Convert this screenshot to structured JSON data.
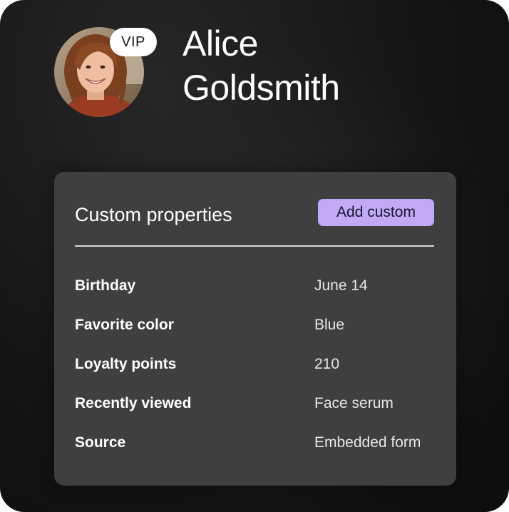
{
  "profile": {
    "first_name": "Alice",
    "last_name": "Goldsmith",
    "badge": "VIP"
  },
  "custom_properties": {
    "title": "Custom properties",
    "add_button_label": "Add custom",
    "items": [
      {
        "label": "Birthday",
        "value": "June 14"
      },
      {
        "label": "Favorite color",
        "value": "Blue"
      },
      {
        "label": "Loyalty points",
        "value": "210"
      },
      {
        "label": "Recently viewed",
        "value": "Face serum"
      },
      {
        "label": "Source",
        "value": "Embedded form"
      }
    ]
  },
  "colors": {
    "background": "#141414",
    "card": "#3f3f3f",
    "accent": "#c2a9f3",
    "text": "#ffffff"
  }
}
